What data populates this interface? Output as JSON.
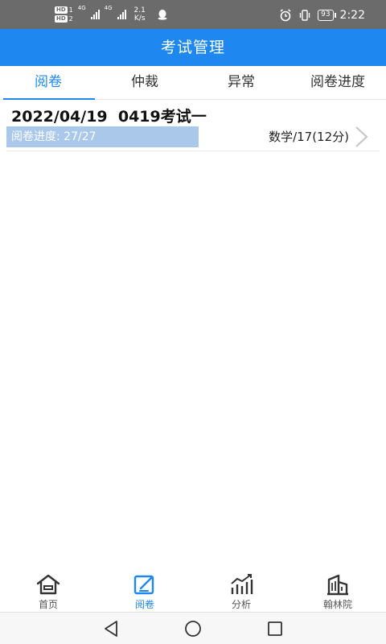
{
  "status_bar": {
    "sim1_label": "HD",
    "sim1_index": "1",
    "sim2_label": "HD",
    "sim2_index": "2",
    "network1": "4G",
    "network2": "4G",
    "speed_value": "2.1",
    "speed_unit": "K/s",
    "battery": "93",
    "time": "2:22",
    "icons": [
      "qq-icon",
      "alarm-icon",
      "vibrate-icon",
      "battery-icon"
    ]
  },
  "header": {
    "title": "考试管理"
  },
  "tabs": [
    {
      "label": "阅卷",
      "active": true
    },
    {
      "label": "仲裁",
      "active": false
    },
    {
      "label": "异常",
      "active": false
    },
    {
      "label": "阅卷进度",
      "active": false
    }
  ],
  "exam": {
    "title": "2022/04/19  0419考试一",
    "progress_text": "阅卷进度: 27/27",
    "progress_fraction": 1.0,
    "subject": "数学/17(12分)"
  },
  "bottom_nav": [
    {
      "label": "首页",
      "icon": "home-icon",
      "active": false
    },
    {
      "label": "阅卷",
      "icon": "grading-icon",
      "active": true
    },
    {
      "label": "分析",
      "icon": "analysis-icon",
      "active": false
    },
    {
      "label": "翰林院",
      "icon": "building-icon",
      "active": false
    }
  ],
  "colors": {
    "primary": "#1e88f0",
    "progress_fill": "#a9c8ea",
    "status_bar": "#6b6b6b",
    "icon_dark": "#333333"
  }
}
